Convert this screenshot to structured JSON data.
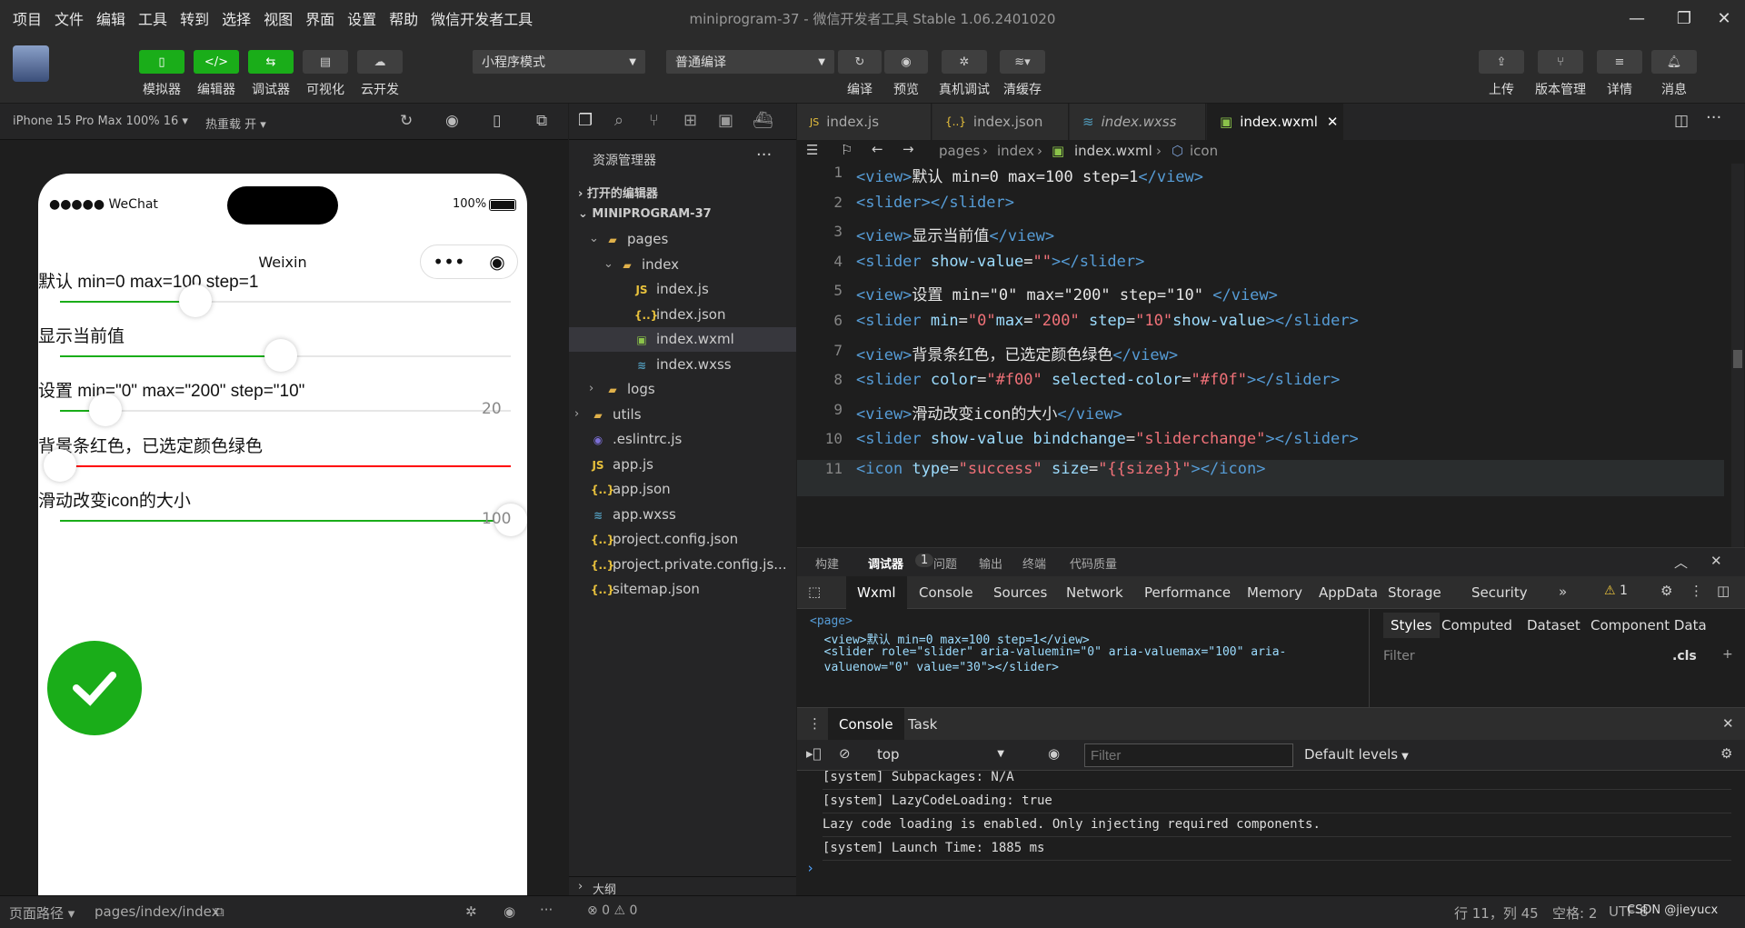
{
  "menu": [
    "项目",
    "文件",
    "编辑",
    "工具",
    "转到",
    "选择",
    "视图",
    "界面",
    "设置",
    "帮助",
    "微信开发者工具"
  ],
  "window_title": "miniprogram-37 - 微信开发者工具 Stable 1.06.2401020",
  "toolbar": {
    "simulator": "模拟器",
    "editor": "编辑器",
    "debugger": "调试器",
    "visual": "可视化",
    "cloud": "云开发",
    "mode_select": "小程序模式",
    "compile_select": "普通编译",
    "compile": "编译",
    "preview": "预览",
    "real_debug": "真机调试",
    "clear_cache": "清缓存",
    "upload": "上传",
    "version": "版本管理",
    "details": "详情",
    "messages": "消息"
  },
  "simulator": {
    "device": "iPhone 15 Pro Max 100% 16 ▾",
    "hot_reload": "热重载 开 ▾",
    "status_left": "●●●●● WeChat",
    "battery": "100%",
    "nav_title": "Weixin",
    "labels": [
      "默认 min=0 max=100 step=1",
      "显示当前值",
      "设置 min=\"0\" max=\"200\" step=\"10\"",
      "背景条红色，已选定颜色绿色",
      "滑动改变icon的大小"
    ],
    "sliders": [
      {
        "fill": 0.3,
        "color": "#1aad19",
        "track": "#e6e6e6",
        "value": ""
      },
      {
        "fill": 0.49,
        "color": "#1aad19",
        "track": "#e6e6e6",
        "value": ""
      },
      {
        "fill": 0.1,
        "color": "#1aad19",
        "track": "#e6e6e6",
        "value": "20"
      },
      {
        "fill": 0.0,
        "color": "#0f0",
        "track": "#f00",
        "value": ""
      },
      {
        "fill": 1.0,
        "color": "#1aad19",
        "track": "#e6e6e6",
        "value": "100"
      }
    ]
  },
  "explorer": {
    "title": "资源管理器",
    "open_editors": "打开的编辑器",
    "project": "MINIPROGRAM-37",
    "items": [
      {
        "name": "pages",
        "type": "folder"
      },
      {
        "name": "index",
        "type": "folder"
      },
      {
        "name": "index.js",
        "type": "js"
      },
      {
        "name": "index.json",
        "type": "json"
      },
      {
        "name": "index.wxml",
        "type": "wxml"
      },
      {
        "name": "index.wxss",
        "type": "wxss"
      },
      {
        "name": "logs",
        "type": "folder"
      },
      {
        "name": "utils",
        "type": "folder"
      },
      {
        "name": ".eslintrc.js",
        "type": "eslint"
      },
      {
        "name": "app.js",
        "type": "js"
      },
      {
        "name": "app.json",
        "type": "json"
      },
      {
        "name": "app.wxss",
        "type": "wxss"
      },
      {
        "name": "project.config.json",
        "type": "json"
      },
      {
        "name": "project.private.config.js...",
        "type": "json"
      },
      {
        "name": "sitemap.json",
        "type": "json"
      }
    ],
    "outline": "大纲"
  },
  "tabs": [
    "index.js",
    "index.json",
    "index.wxss",
    "index.wxml"
  ],
  "breadcrumb": [
    "pages",
    "index",
    "index.wxml",
    "icon"
  ],
  "code_lines": [
    [
      [
        "tg",
        "<view>"
      ],
      [
        "tx",
        "默认 min=0 max=100 step=1"
      ],
      [
        "tg",
        "</view>"
      ]
    ],
    [
      [
        "tg",
        "<slider></slider>"
      ]
    ],
    [
      [
        "tg",
        "<view>"
      ],
      [
        "tx",
        "显示当前值"
      ],
      [
        "tg",
        "</view>"
      ]
    ],
    [
      [
        "tg",
        "<slider "
      ],
      [
        "at",
        "show-value"
      ],
      [
        "tx",
        "="
      ],
      [
        "st",
        "\"\""
      ],
      [
        "tg",
        "></slider>"
      ]
    ],
    [
      [
        "tg",
        "<view>"
      ],
      [
        "tx",
        "设置 min=\"0\" max=\"200\" step=\"10\" "
      ],
      [
        "tg",
        "</view>"
      ]
    ],
    [
      [
        "tg",
        "<slider "
      ],
      [
        "at",
        "min"
      ],
      [
        "tx",
        "="
      ],
      [
        "st",
        "\"0\""
      ],
      [
        "at",
        "max"
      ],
      [
        "tx",
        "="
      ],
      [
        "st",
        "\"200\""
      ],
      [
        "at",
        " step"
      ],
      [
        "tx",
        "="
      ],
      [
        "st",
        "\"10\""
      ],
      [
        "at",
        "show-value"
      ],
      [
        "tg",
        "></slider>"
      ]
    ],
    [
      [
        "tg",
        "<view>"
      ],
      [
        "tx",
        "背景条红色，已选定颜色绿色"
      ],
      [
        "tg",
        "</view>"
      ]
    ],
    [
      [
        "tg",
        "<slider "
      ],
      [
        "at",
        "color"
      ],
      [
        "tx",
        "="
      ],
      [
        "st",
        "\"#f00\""
      ],
      [
        "at",
        " selected-color"
      ],
      [
        "tx",
        "="
      ],
      [
        "st",
        "\"#f0f\""
      ],
      [
        "tg",
        "></slider>"
      ]
    ],
    [
      [
        "tg",
        "<view>"
      ],
      [
        "tx",
        "滑动改变icon的大小"
      ],
      [
        "tg",
        "</view>"
      ]
    ],
    [
      [
        "tg",
        "<slider "
      ],
      [
        "at",
        "show-value bindchange"
      ],
      [
        "tx",
        "="
      ],
      [
        "st",
        "\"sliderchange\""
      ],
      [
        "tg",
        "></slider>"
      ]
    ],
    [
      [
        "tg",
        "<icon "
      ],
      [
        "at",
        "type"
      ],
      [
        "tx",
        "="
      ],
      [
        "st",
        "\"success\""
      ],
      [
        "at",
        " size"
      ],
      [
        "tx",
        "="
      ],
      [
        "st",
        "\"{{size}}\""
      ],
      [
        "tg",
        "></icon>"
      ]
    ]
  ],
  "devtools": {
    "top_tabs": [
      "构建",
      "调试器",
      "问题",
      "输出",
      "终端",
      "代码质量"
    ],
    "debugger_badge": "1",
    "panel_tabs": [
      "Wxml",
      "Console",
      "Sources",
      "Network",
      "Performance",
      "Memory",
      "AppData",
      "Storage",
      "Security"
    ],
    "warning_count": "1",
    "elements": [
      "<page>",
      "  <view>默认 min=0 max=100 step=1</view>",
      "  <slider role=\"slider\" aria-valuemin=\"0\" aria-valuemax=\"100\" aria-",
      "  valuenow=\"0\" value=\"30\"></slider>"
    ],
    "style_tabs": [
      "Styles",
      "Computed",
      "Dataset",
      "Component Data"
    ],
    "styles_filter": "Filter",
    "cls": ".cls",
    "console_tabs": [
      "Console",
      "Task"
    ],
    "context": "top",
    "filter_placeholder": "Filter",
    "levels": "Default levels",
    "logs": [
      "[system] Subpackages: N/A",
      "[system] LazyCodeLoading: true",
      "Lazy code loading is enabled. Only injecting required components.",
      "[system] Launch Time: 1885 ms"
    ],
    "prompt": "›"
  },
  "status": {
    "page_path_label": "页面路径",
    "page_path": "pages/index/index",
    "errors": "⊗ 0 ⚠ 0",
    "cursor": "行 11，列 45",
    "spaces": "空格: 2",
    "encoding": "UTF-8",
    "watermark": "CSDN @jieyucx"
  }
}
